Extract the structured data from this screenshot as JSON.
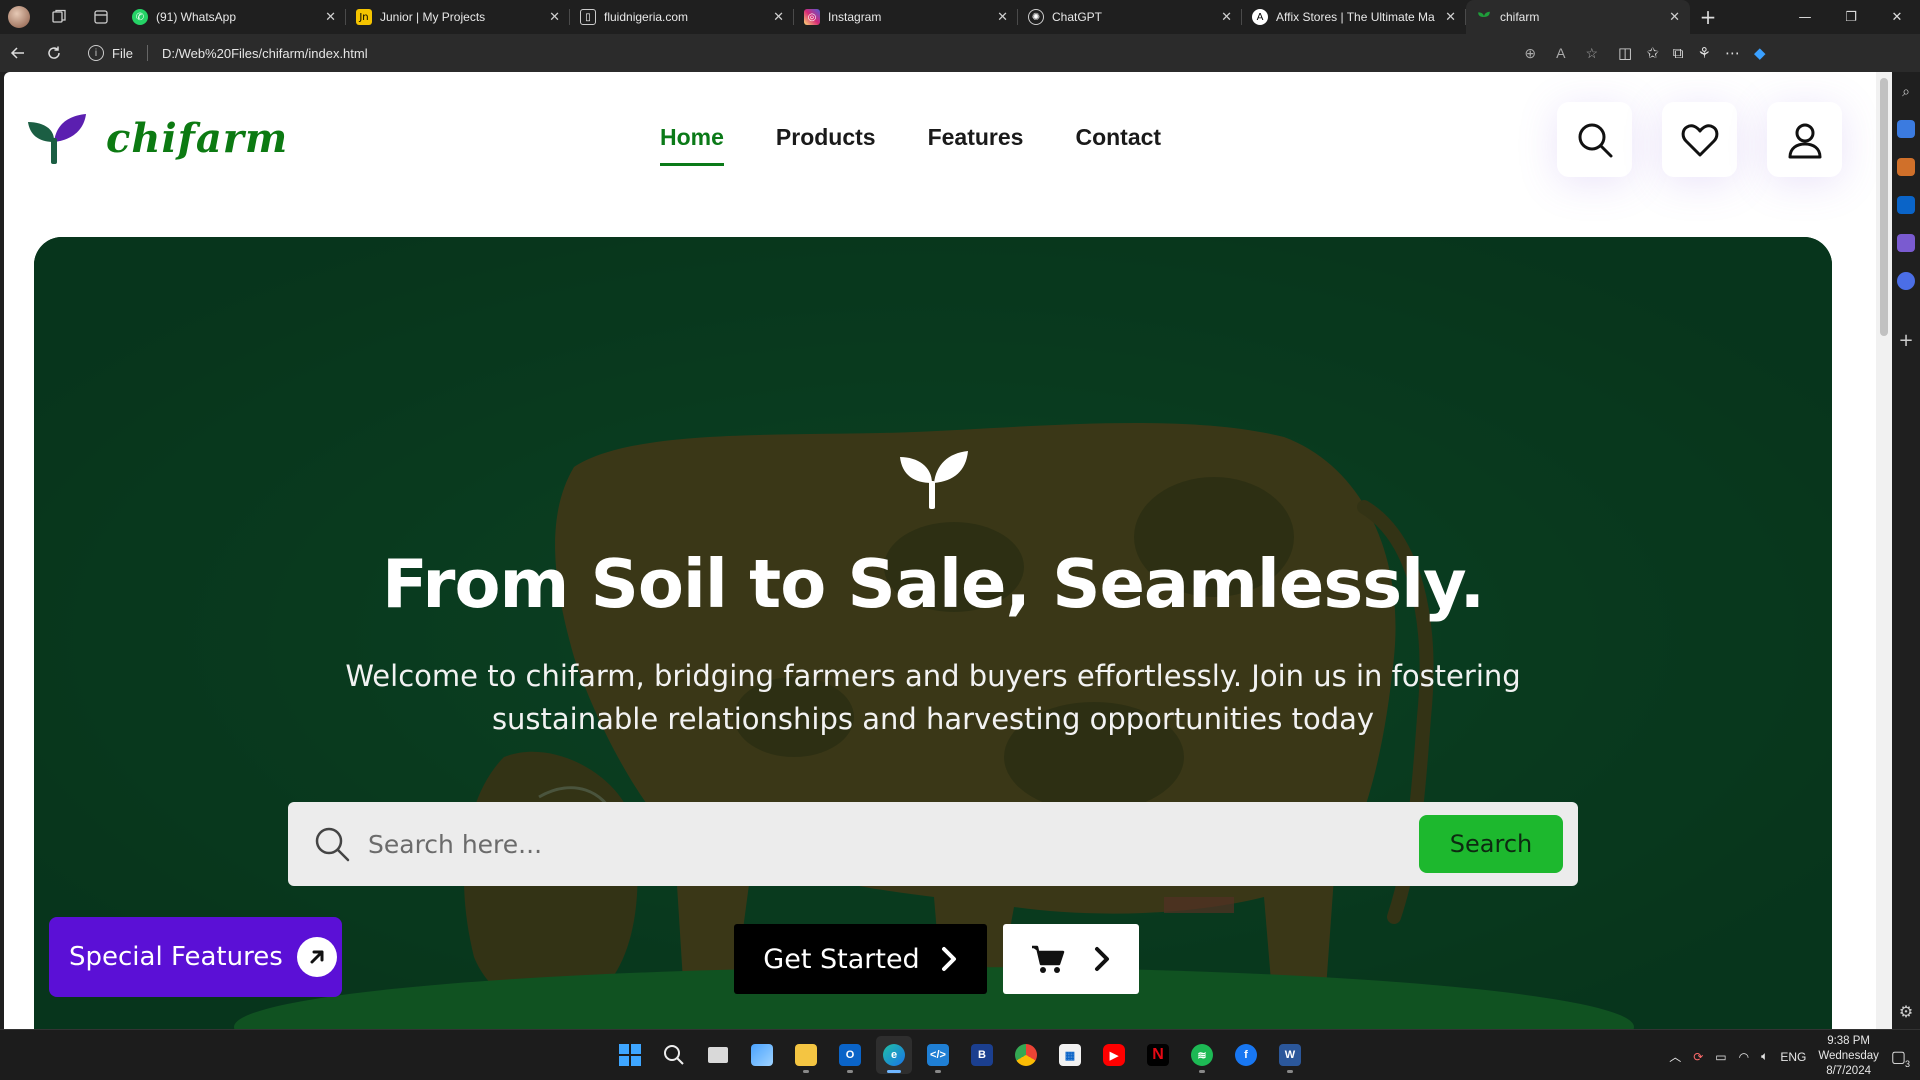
{
  "browser": {
    "tabs": [
      {
        "title": "(91) WhatsApp",
        "favicon": "whatsapp-icon",
        "color": "#25d366"
      },
      {
        "title": "Junior | My Projects",
        "favicon": "junior-icon",
        "color": "#f5c400"
      },
      {
        "title": "fluidnigeria.com",
        "favicon": "page-icon",
        "color": "#555555"
      },
      {
        "title": "Instagram",
        "favicon": "instagram-icon",
        "color": "#d62976"
      },
      {
        "title": "ChatGPT",
        "favicon": "chatgpt-icon",
        "color": "#555555"
      },
      {
        "title": "Affix Stores | The Ultimate Ma",
        "favicon": "affix-icon",
        "color": "#444444"
      },
      {
        "title": "chifarm",
        "favicon": "chifarm-icon",
        "color": "#1f9d3a",
        "active": true
      }
    ],
    "address": {
      "scheme": "File",
      "url": "D:/Web%20Files/chifarm/index.html"
    }
  },
  "site": {
    "brand": "chifarm",
    "brand_color": "#0c7a12",
    "nav": [
      {
        "label": "Home",
        "active": true
      },
      {
        "label": "Products"
      },
      {
        "label": "Features"
      },
      {
        "label": "Contact"
      }
    ],
    "header_icons": [
      "search-icon",
      "heart-icon",
      "user-icon"
    ],
    "hero": {
      "title": "From Soil to Sale, Seamlessly.",
      "subtitle": "Welcome to chifarm, bridging farmers and buyers effortlessly. Join us in fostering sustainable relationships and harvesting opportunities today",
      "search_placeholder": "Search here...",
      "search_button": "Search",
      "cta_label": "Get Started",
      "cart_icon": "cart-icon"
    },
    "special_features": "Special Features",
    "accent_green": "#1db82e",
    "accent_purple": "#5b10d6"
  },
  "taskbar": {
    "apps": [
      "windows-start-icon",
      "search-icon",
      "task-view-icon",
      "widgets-icon",
      "file-explorer-icon",
      "outlook-icon",
      "edge-icon",
      "vscode-icon",
      "b-app-icon",
      "chrome-icon",
      "store-icon",
      "youtube-icon",
      "netflix-icon",
      "spotify-icon",
      "facebook-icon",
      "word-icon"
    ],
    "tray": {
      "language": "ENG",
      "time": "9:38 PM",
      "day": "Wednesday",
      "date": "8/7/2024",
      "notifications": "3"
    }
  }
}
